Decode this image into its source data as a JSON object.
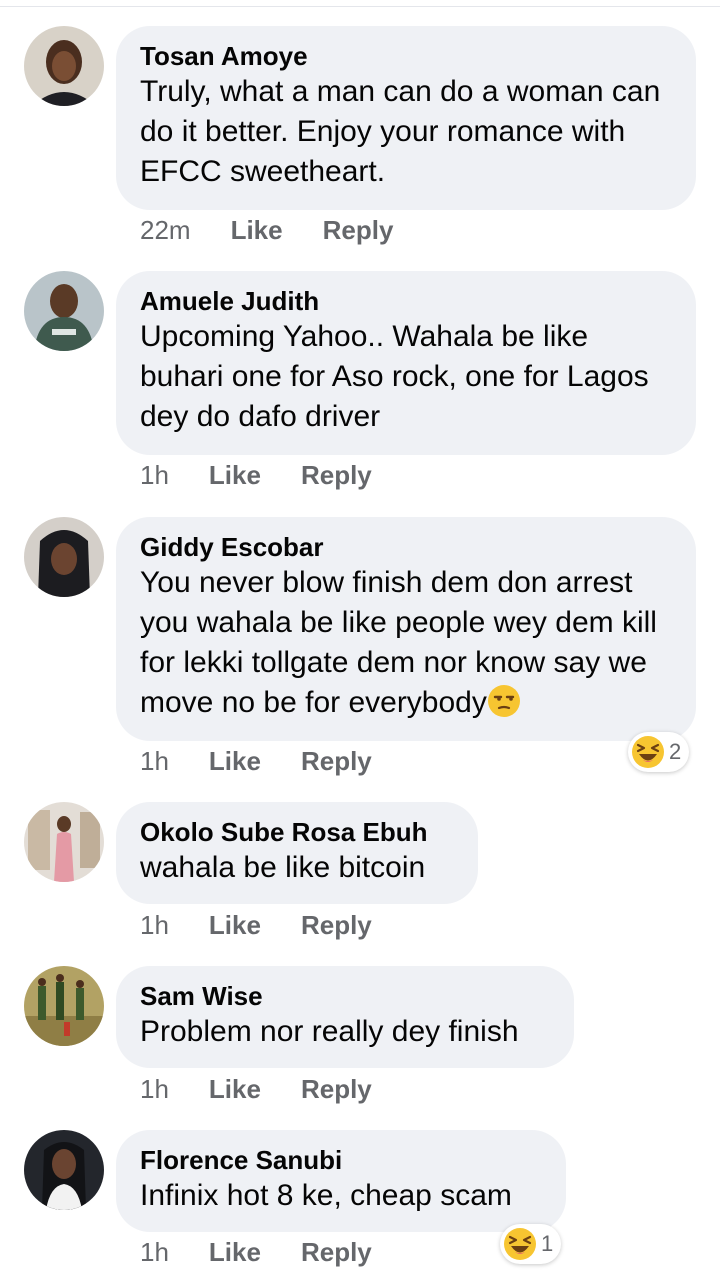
{
  "comments": [
    {
      "author": "Tosan Amoye",
      "text": "Truly, what a man can do a woman can do it better. Enjoy your romance with EFCC sweetheart.",
      "time": "22m",
      "like": "Like",
      "reply": "Reply"
    },
    {
      "author": "Amuele Judith",
      "text": "Upcoming Yahoo.. Wahala be like buhari one for Aso rock, one for Lagos dey do dafo driver",
      "time": "1h",
      "like": "Like",
      "reply": "Reply"
    },
    {
      "author": "Giddy Escobar",
      "text": "You never blow finish dem don arrest you wahala be like people wey dem kill for lekki tollgate dem nor know say we move no be for everybody",
      "inline_emoji": "unamused-face",
      "time": "1h",
      "like": "Like",
      "reply": "Reply",
      "reaction_icon": "laughing-face",
      "reaction_count": "2"
    },
    {
      "author": "Okolo Sube Rosa Ebuh",
      "text": "wahala be like bitcoin",
      "time": "1h",
      "like": "Like",
      "reply": "Reply"
    },
    {
      "author": "Sam Wise",
      "text": "Problem nor really dey finish",
      "time": "1h",
      "like": "Like",
      "reply": "Reply"
    },
    {
      "author": "Florence Sanubi",
      "text": "Infinix hot 8 ke, cheap scam",
      "time": "1h",
      "like": "Like",
      "reply": "Reply",
      "reaction_icon": "laughing-face",
      "reaction_count": "1"
    }
  ],
  "colors": {
    "bubble": "#eff1f5",
    "meta_text": "#65676b",
    "primary_text": "#050505"
  }
}
